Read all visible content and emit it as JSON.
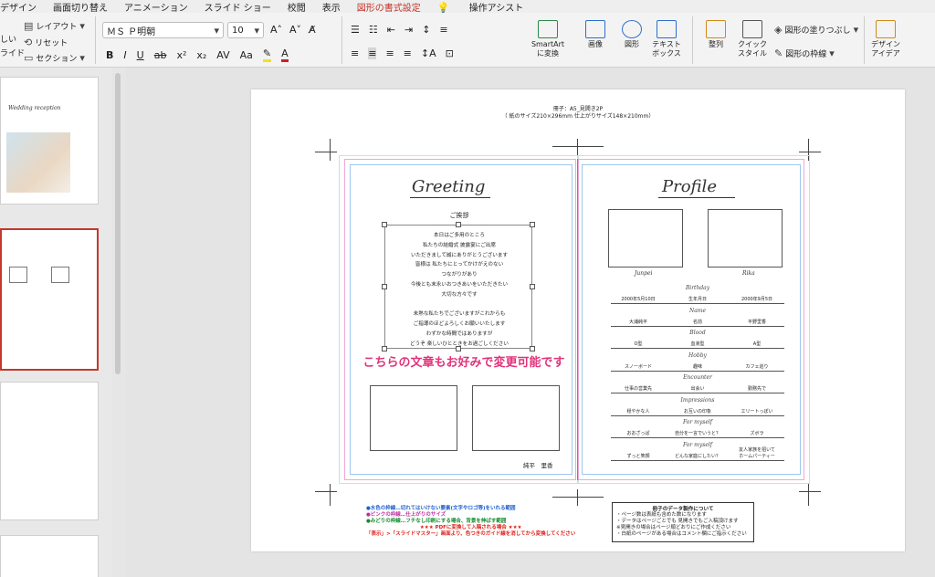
{
  "ribbon_tabs": [
    "デザイン",
    "画面切り替え",
    "アニメーション",
    "スライド ショー",
    "校閲",
    "表示",
    "図形の書式設定",
    "操作アシスト"
  ],
  "ribbon": {
    "new_slide_1": "しい",
    "new_slide_2": "ライド",
    "layout": "レイアウト",
    "reset": "リセット",
    "section": "セクション",
    "font_name": "ＭＳ Ｐ明朝",
    "font_size": "10",
    "smartart": "SmartArt\nに変換",
    "image": "画像",
    "shape": "図形",
    "textbox": "テキスト\nボックス",
    "arrange": "整列",
    "quick_style": "クイック\nスタイル",
    "shape_fill": "図形の塗りつぶし",
    "shape_outline": "図形の枠線",
    "design_ideas": "デザイン\nアイデア"
  },
  "slide": {
    "header_line1": "冊子：A5_見開き2P",
    "header_line2": "（ 紙のサイズ210×296mm  仕上がりサイズ148×210mm）",
    "greeting_title": "Greeting",
    "greeting_sub": "ご挨拶",
    "greeting_lines": [
      "本日はご多用のところ",
      "私たちの結婚式 披露宴にご出席",
      "いただきまして誠にありがとうございます",
      "皆様は 私たちにとってかけがえのない",
      "つながりがあり",
      "今後とも末永いおつきあいをいただきたい",
      "大切な方々です",
      "",
      "未熟な私たちでございますがこれからも",
      "ご指導のほどよろしくお願いいたします",
      "わずかな時間ではありますが",
      "どうぞ 楽しいひとときをお過ごしください"
    ],
    "overlay_text": "こちらの文章もお好みで変更可能です",
    "signature": "純平　里香",
    "profile_title": "Profile",
    "groom_name": "Junpei",
    "bride_name": "Rika",
    "rows": [
      {
        "label": "Birthday",
        "left": "2000年5月10日",
        "mid": "生年月日",
        "right": "2000年9月5日"
      },
      {
        "label": "Name",
        "left": "大浦純平",
        "mid": "名前",
        "right": "平野里香"
      },
      {
        "label": "Blood",
        "left": "O型",
        "mid": "血液型",
        "right": "A型"
      },
      {
        "label": "Hobby",
        "left": "スノーボード",
        "mid": "趣味",
        "right": "カフェ巡り"
      },
      {
        "label": "Encounter",
        "left": "仕事の営業先",
        "mid": "出会い",
        "right": "勤務先で"
      },
      {
        "label": "Impressions",
        "left": "穏やかな人",
        "mid": "お互いの印象",
        "right": "エリートっぽい"
      },
      {
        "label": "For myself",
        "left": "おおざっぱ",
        "mid": "自分を一言でいうと？",
        "right": "ズボラ"
      },
      {
        "label": "For myself",
        "left": "ずっと笑顔",
        "mid": "どんな家庭にしたい？",
        "right": "友人家族を招いて\nホームパーティー"
      }
    ],
    "legend": [
      {
        "text": "●水色の枠線…切れてはいけない要素(文字やロゴ等)をいれる範囲",
        "color": "#1f5fd0"
      },
      {
        "text": "●ピンクの枠線…仕上がりのサイズ",
        "color": "#c02ea0"
      },
      {
        "text": "●みどりの枠線…フチなし印刷にする場合、背景を伸ばす範囲",
        "color": "#138a2e"
      },
      {
        "text": "★★★ PDFに変換して入稿される場合 ★★★",
        "color": "#e0201a"
      },
      {
        "text": "「表示」>「スライドマスター」画面より、色つきのガイド線を消してから変換してください",
        "color": "#e0201a"
      }
    ],
    "data_box_title": "冊子のデータ製作について",
    "data_box_lines": [
      "・ページ数は表紙も含めた数になります",
      "・データはページごとでも 見開きでもご入稿頂けます",
      "※見開きの場合はページ順どおりにご作成ください",
      "・白紙のページがある場合はコメント欄にご指示ください"
    ]
  },
  "thumbnails": {
    "thumb1_title": "Wedding reception"
  }
}
